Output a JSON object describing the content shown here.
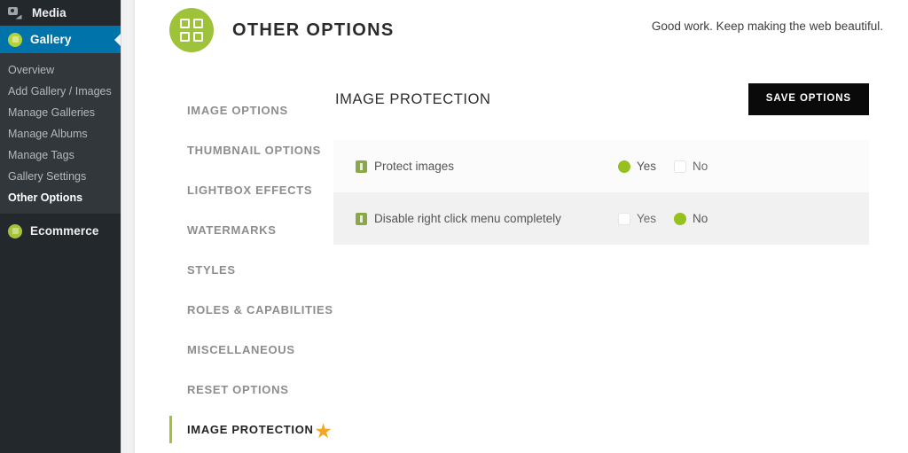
{
  "sidebar": {
    "top_items": [
      {
        "label": "Media",
        "icon": "media-camera-icon",
        "active": false
      },
      {
        "label": "Gallery",
        "icon": "gallery-circle-icon",
        "active": true
      }
    ],
    "submenu": [
      {
        "label": "Overview",
        "current": false
      },
      {
        "label": "Add Gallery / Images",
        "current": false
      },
      {
        "label": "Manage Galleries",
        "current": false
      },
      {
        "label": "Manage Albums",
        "current": false
      },
      {
        "label": "Manage Tags",
        "current": false
      },
      {
        "label": "Gallery Settings",
        "current": false
      },
      {
        "label": "Other Options",
        "current": true
      }
    ],
    "ecommerce": {
      "label": "Ecommerce",
      "icon": "ecommerce-circle-icon"
    }
  },
  "header": {
    "title": "OTHER OPTIONS",
    "logo_icon": "four-squares-grid-icon",
    "note": "Good work. Keep making the web beautiful."
  },
  "tabs": [
    {
      "label": "IMAGE OPTIONS",
      "active": false
    },
    {
      "label": "THUMBNAIL OPTIONS",
      "active": false
    },
    {
      "label": "LIGHTBOX EFFECTS",
      "active": false
    },
    {
      "label": "WATERMARKS",
      "active": false
    },
    {
      "label": "STYLES",
      "active": false
    },
    {
      "label": "ROLES & CAPABILITIES",
      "active": false
    },
    {
      "label": "MISCELLANEOUS",
      "active": false
    },
    {
      "label": "RESET OPTIONS",
      "active": false
    },
    {
      "label": "IMAGE PROTECTION",
      "active": true,
      "badge_icon": "star-icon",
      "badge_glyph": "★"
    }
  ],
  "panel": {
    "title": "IMAGE PROTECTION",
    "save_label": "SAVE OPTIONS",
    "options": [
      {
        "label": "Protect images",
        "info_icon": "info-icon",
        "yes_label": "Yes",
        "no_label": "No",
        "selected": "Yes"
      },
      {
        "label": "Disable right click menu completely",
        "info_icon": "info-icon",
        "yes_label": "Yes",
        "no_label": "No",
        "selected": "No"
      }
    ]
  },
  "colors": {
    "brand_green": "#9ec33b",
    "radio_green": "#95c11f",
    "wp_dark": "#23282d",
    "wp_submenu": "#32373c",
    "wp_active_blue": "#0073aa",
    "star_orange": "#f5a623",
    "save_button_bg": "#0a0a0a"
  }
}
